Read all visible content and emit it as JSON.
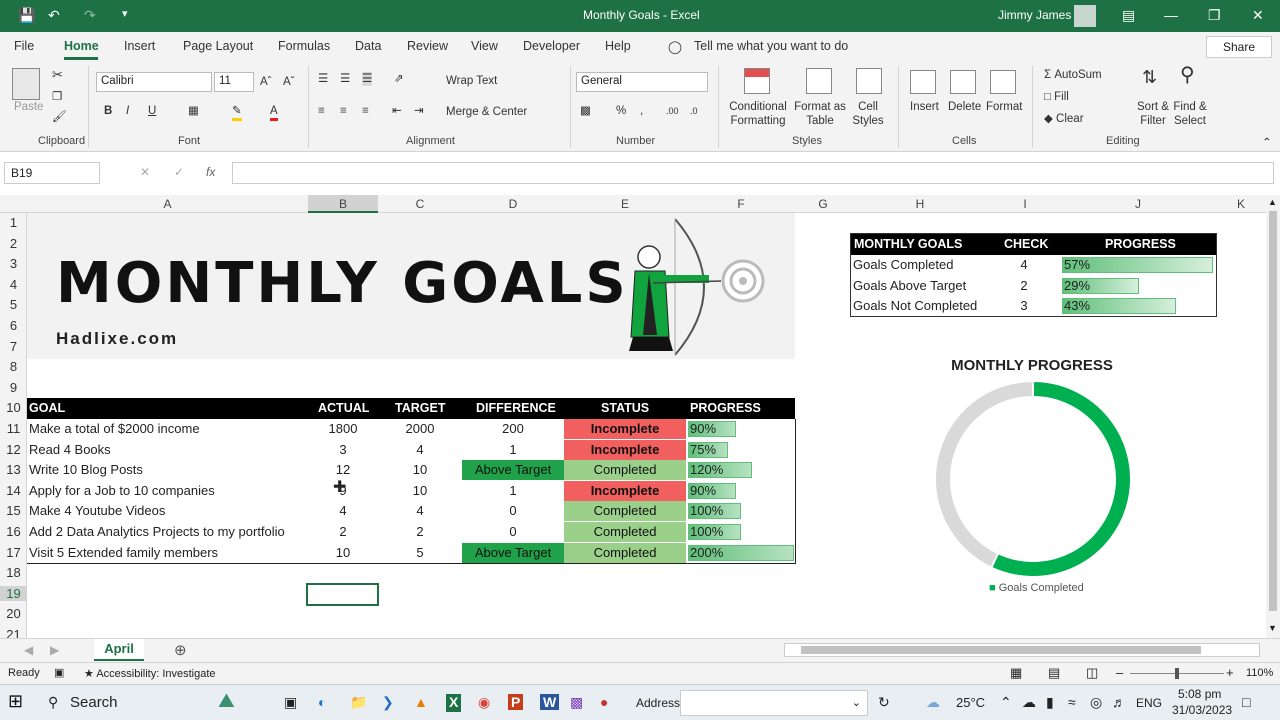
{
  "window": {
    "title": "Monthly Goals  -  Excel",
    "user": "Jimmy James"
  },
  "menu": [
    "File",
    "Home",
    "Insert",
    "Page Layout",
    "Formulas",
    "Data",
    "Review",
    "View",
    "Developer",
    "Help"
  ],
  "tell_me": "Tell me what you want to do",
  "share": "Share",
  "ribbon": {
    "clipboard": {
      "paste": "Paste",
      "label": "Clipboard"
    },
    "font": {
      "name": "Calibri",
      "size": "11",
      "label": "Font",
      "bold": "B",
      "italic": "I",
      "underline": "U"
    },
    "alignment": {
      "wrap": "Wrap Text",
      "merge": "Merge & Center",
      "label": "Alignment"
    },
    "number": {
      "format": "General",
      "label": "Number"
    },
    "styles": {
      "cond": "Conditional",
      "cond2": "Formatting",
      "fmt": "Format as",
      "fmt2": "Table",
      "cell": "Cell",
      "cell2": "Styles",
      "label": "Styles"
    },
    "cells": {
      "insert": "Insert",
      "delete": "Delete",
      "format": "Format",
      "label": "Cells"
    },
    "editing": {
      "autosum": "AutoSum",
      "fill": "Fill",
      "clear": "Clear",
      "sort": "Sort &",
      "sort2": "Filter",
      "find": "Find &",
      "find2": "Select",
      "label": "Editing"
    }
  },
  "namebox": "B19",
  "columns": [
    "A",
    "B",
    "C",
    "D",
    "E",
    "F",
    "G",
    "H",
    "I",
    "J",
    "K"
  ],
  "rows": [
    "1",
    "2",
    "3",
    "4",
    "5",
    "6",
    "7",
    "8",
    "9",
    "10",
    "11",
    "12",
    "13",
    "14",
    "15",
    "16",
    "17",
    "18",
    "19",
    "20",
    "21"
  ],
  "banner": {
    "title": "MONTHLY GOALS",
    "site": "Hadlixe.com"
  },
  "goals": {
    "headers": {
      "goal": "GOAL",
      "actual": "ACTUAL",
      "target": "TARGET",
      "diff": "DIFFERENCE",
      "status": "STATUS",
      "progress": "PROGRESS"
    },
    "rows": [
      {
        "goal": "Make a total of $2000 income",
        "actual": "1800",
        "target": "2000",
        "diff": "200",
        "status": "Incomplete",
        "progress": "90%",
        "pct": 0.9
      },
      {
        "goal": "Read 4 Books",
        "actual": "3",
        "target": "4",
        "diff": "1",
        "status": "Incomplete",
        "progress": "75%",
        "pct": 0.75
      },
      {
        "goal": "Write 10 Blog Posts",
        "actual": "12",
        "target": "10",
        "diff": "Above Target",
        "status": "Completed",
        "progress": "120%",
        "pct": 1.2
      },
      {
        "goal": "Apply for a Job to 10 companies",
        "actual": "9",
        "target": "10",
        "diff": "1",
        "status": "Incomplete",
        "progress": "90%",
        "pct": 0.9
      },
      {
        "goal": "Make 4 Youtube Videos",
        "actual": "4",
        "target": "4",
        "diff": "0",
        "status": "Completed",
        "progress": "100%",
        "pct": 1.0
      },
      {
        "goal": "Add 2 Data Analytics Projects to my portfolio",
        "actual": "2",
        "target": "2",
        "diff": "0",
        "status": "Completed",
        "progress": "100%",
        "pct": 1.0
      },
      {
        "goal": "Visit 5 Extended family members",
        "actual": "10",
        "target": "5",
        "diff": "Above Target",
        "status": "Completed",
        "progress": "200%",
        "pct": 2.0
      }
    ]
  },
  "summary": {
    "headers": {
      "a": "MONTHLY GOALS",
      "b": "CHECK",
      "c": "PROGRESS"
    },
    "rows": [
      {
        "label": "Goals Completed",
        "check": "4",
        "progress": "57%",
        "pct": 0.57
      },
      {
        "label": "Goals Above Target",
        "check": "2",
        "progress": "29%",
        "pct": 0.29
      },
      {
        "label": "Goals Not Completed",
        "check": "3",
        "progress": "43%",
        "pct": 0.43
      }
    ]
  },
  "chart_data": {
    "type": "pie",
    "title": "MONTHLY PROGRESS",
    "categories": [
      "Goals Completed",
      ""
    ],
    "values": [
      57,
      43
    ],
    "legend": "Goals Completed",
    "colors": [
      "#00b050",
      "#d9d9d9"
    ]
  },
  "sheet_tab": "April",
  "status": {
    "ready": "Ready",
    "access": "Accessibility: Investigate",
    "zoom": "110%"
  },
  "taskbar": {
    "search": "Search",
    "address": "Address",
    "temp": "25°C",
    "lang": "ENG",
    "time": "5:08 pm",
    "date": "31/03/2023"
  },
  "colors": {
    "excel_green": "#1e7145",
    "incomplete": "#f25f5f",
    "completed": "#9ad08a",
    "above": "#1fa24a"
  }
}
